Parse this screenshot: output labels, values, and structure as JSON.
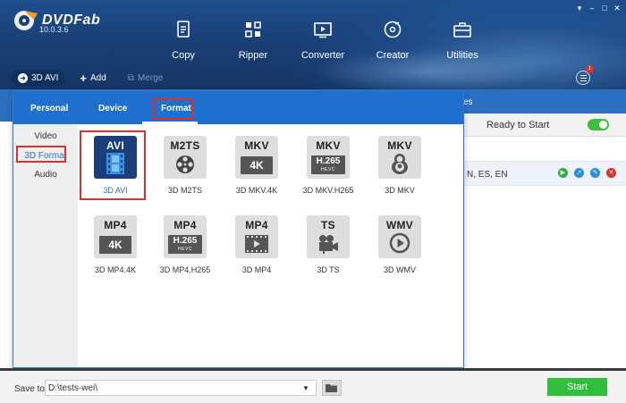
{
  "app": {
    "name": "DVDFab",
    "version": "10.0.3.6"
  },
  "nav": [
    {
      "label": "Copy",
      "icon": "copy-icon"
    },
    {
      "label": "Ripper",
      "icon": "ripper-icon"
    },
    {
      "label": "Converter",
      "icon": "converter-icon"
    },
    {
      "label": "Creator",
      "icon": "creator-icon"
    },
    {
      "label": "Utilities",
      "icon": "toolbox-icon"
    }
  ],
  "window_controls": [
    "▾",
    "–",
    "□",
    "✕"
  ],
  "toolbar": {
    "profile_label": "3D AVI",
    "add_label": "Add",
    "merge_label": "Merge"
  },
  "notification_count": "1",
  "popup": {
    "tabs": {
      "personal": "Personal",
      "device": "Device",
      "format": "Format"
    },
    "side": {
      "video": "Video",
      "format3d": "3D Format",
      "audio": "Audio"
    },
    "formats": [
      {
        "title": "AVI",
        "label": "3D AVI",
        "glyph": "film-strip",
        "selected": true
      },
      {
        "title": "M2TS",
        "label": "3D M2TS",
        "glyph": "film-reel"
      },
      {
        "title": "MKV",
        "label": "3D MKV.4K",
        "glyph": "4k"
      },
      {
        "title": "MKV",
        "label": "3D MKV.H265",
        "glyph": "h265"
      },
      {
        "title": "MKV",
        "label": "3D MKV",
        "glyph": "matryoshka"
      },
      {
        "title": "MP4",
        "label": "3D MP4.4K",
        "glyph": "4k"
      },
      {
        "title": "MP4",
        "label": "3D MP4.H265",
        "glyph": "h265"
      },
      {
        "title": "MP4",
        "label": "3D MP4",
        "glyph": "play-film"
      },
      {
        "title": "TS",
        "label": "3D TS",
        "glyph": "camera"
      },
      {
        "title": "WMV",
        "label": "3D WMV",
        "glyph": "play-circle"
      }
    ],
    "badge_4k": "4K",
    "badge_h265": "H.265",
    "badge_hevc": "HEVC"
  },
  "background_pane": {
    "tab_fragment": "es",
    "ready_text": "Ready to Start",
    "languages": "N, ES, EN"
  },
  "bottom": {
    "save_to_label": "Save to:",
    "save_path": "D:\\tests-wei\\",
    "start_label": "Start"
  },
  "colors": {
    "header": "#1a3f76",
    "popup_tab_bar": "#1f6fce",
    "highlight_red": "#d8322c",
    "start_green": "#2fbf3a"
  }
}
